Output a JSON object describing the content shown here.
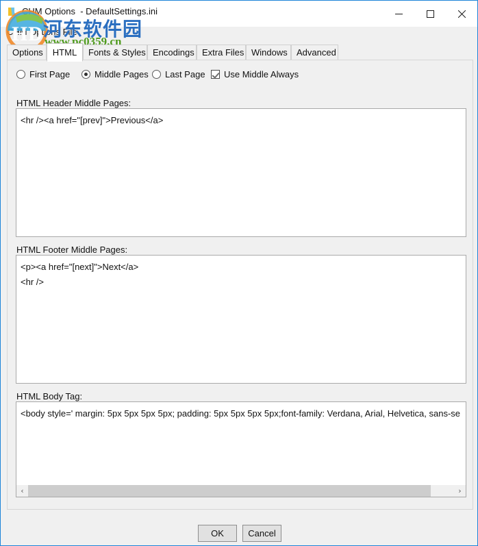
{
  "window": {
    "title": "CHM Options  - DefaultSettings.ini",
    "subtitle": "CHM Options File",
    "accent_color": "#1c84d8",
    "controls": {
      "minimize": "minimize-icon",
      "maximize": "maximize-icon",
      "close": "close-icon"
    }
  },
  "watermark": {
    "chinese": "河东软件园",
    "url": "www.pc0359.cn",
    "chinese_color": "#2b6fc0",
    "url_color": "#4f9b1e"
  },
  "tabs": [
    {
      "label": "Options",
      "selected": false
    },
    {
      "label": "HTML",
      "selected": true
    },
    {
      "label": "Fonts & Styles",
      "selected": false
    },
    {
      "label": "Encodings",
      "selected": false
    },
    {
      "label": "Extra Files",
      "selected": false
    },
    {
      "label": "Windows",
      "selected": false
    },
    {
      "label": "Advanced",
      "selected": false
    }
  ],
  "page_selector": {
    "radios": [
      {
        "label": "First Page",
        "checked": false
      },
      {
        "label": "Middle Pages",
        "checked": true
      },
      {
        "label": "Last Page",
        "checked": false
      }
    ],
    "checkbox": {
      "label": "Use Middle Always",
      "checked": true
    }
  },
  "fields": {
    "header": {
      "label": "HTML Header Middle Pages:",
      "lines": [
        "<hr /><a href=\"[prev]\">Previous</a>"
      ]
    },
    "footer": {
      "label": "HTML Footer Middle Pages:",
      "lines": [
        "<p><a href=\"[next]\">Next</a>",
        "<hr />"
      ]
    },
    "body": {
      "label": "HTML Body Tag:",
      "lines": [
        "<body style=' margin: 5px 5px 5px 5px; padding: 5px 5px 5px 5px;font-family: Verdana, Arial, Helvetica, sans-se"
      ],
      "scrollbar": {
        "left_arrow": "‹",
        "right_arrow": "›"
      }
    }
  },
  "buttons": {
    "ok": "OK",
    "cancel": "Cancel"
  }
}
